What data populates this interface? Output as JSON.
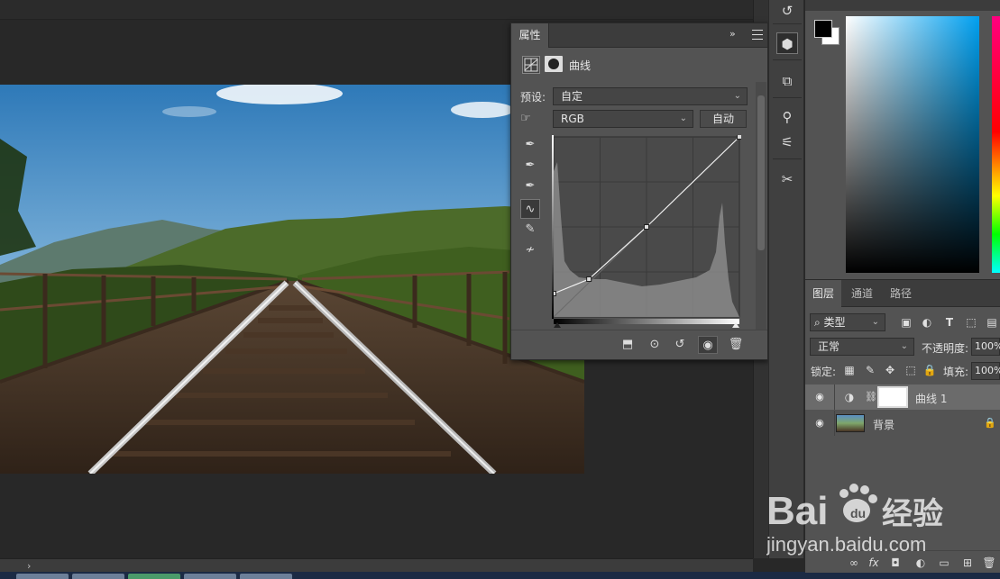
{
  "properties_panel": {
    "tab_label": "属性",
    "title": "曲线",
    "preset_label": "预设:",
    "preset_value": "自定",
    "channel_value": "RGB",
    "auto_button": "自动",
    "curve_points": [
      [
        0,
        0.13
      ],
      [
        0.19,
        0.21
      ],
      [
        0.5,
        0.5
      ],
      [
        1,
        1
      ]
    ]
  },
  "layers_panel": {
    "tabs": [
      "图层",
      "通道",
      "路径"
    ],
    "filter_kind": "类型",
    "blend_mode": "正常",
    "opacity_label": "不透明度:",
    "opacity_value": "100%",
    "lock_label": "锁定:",
    "fill_label": "填充:",
    "fill_value": "100%",
    "layers": [
      {
        "name": "曲线 1",
        "selected": true
      },
      {
        "name": "背景",
        "selected": false
      }
    ]
  },
  "color_panel": {
    "foreground": "#000000",
    "background": "#ffffff"
  },
  "watermark": {
    "brand": "Bai",
    "brand2": "经验",
    "url": "jingyan.baidu.com"
  }
}
